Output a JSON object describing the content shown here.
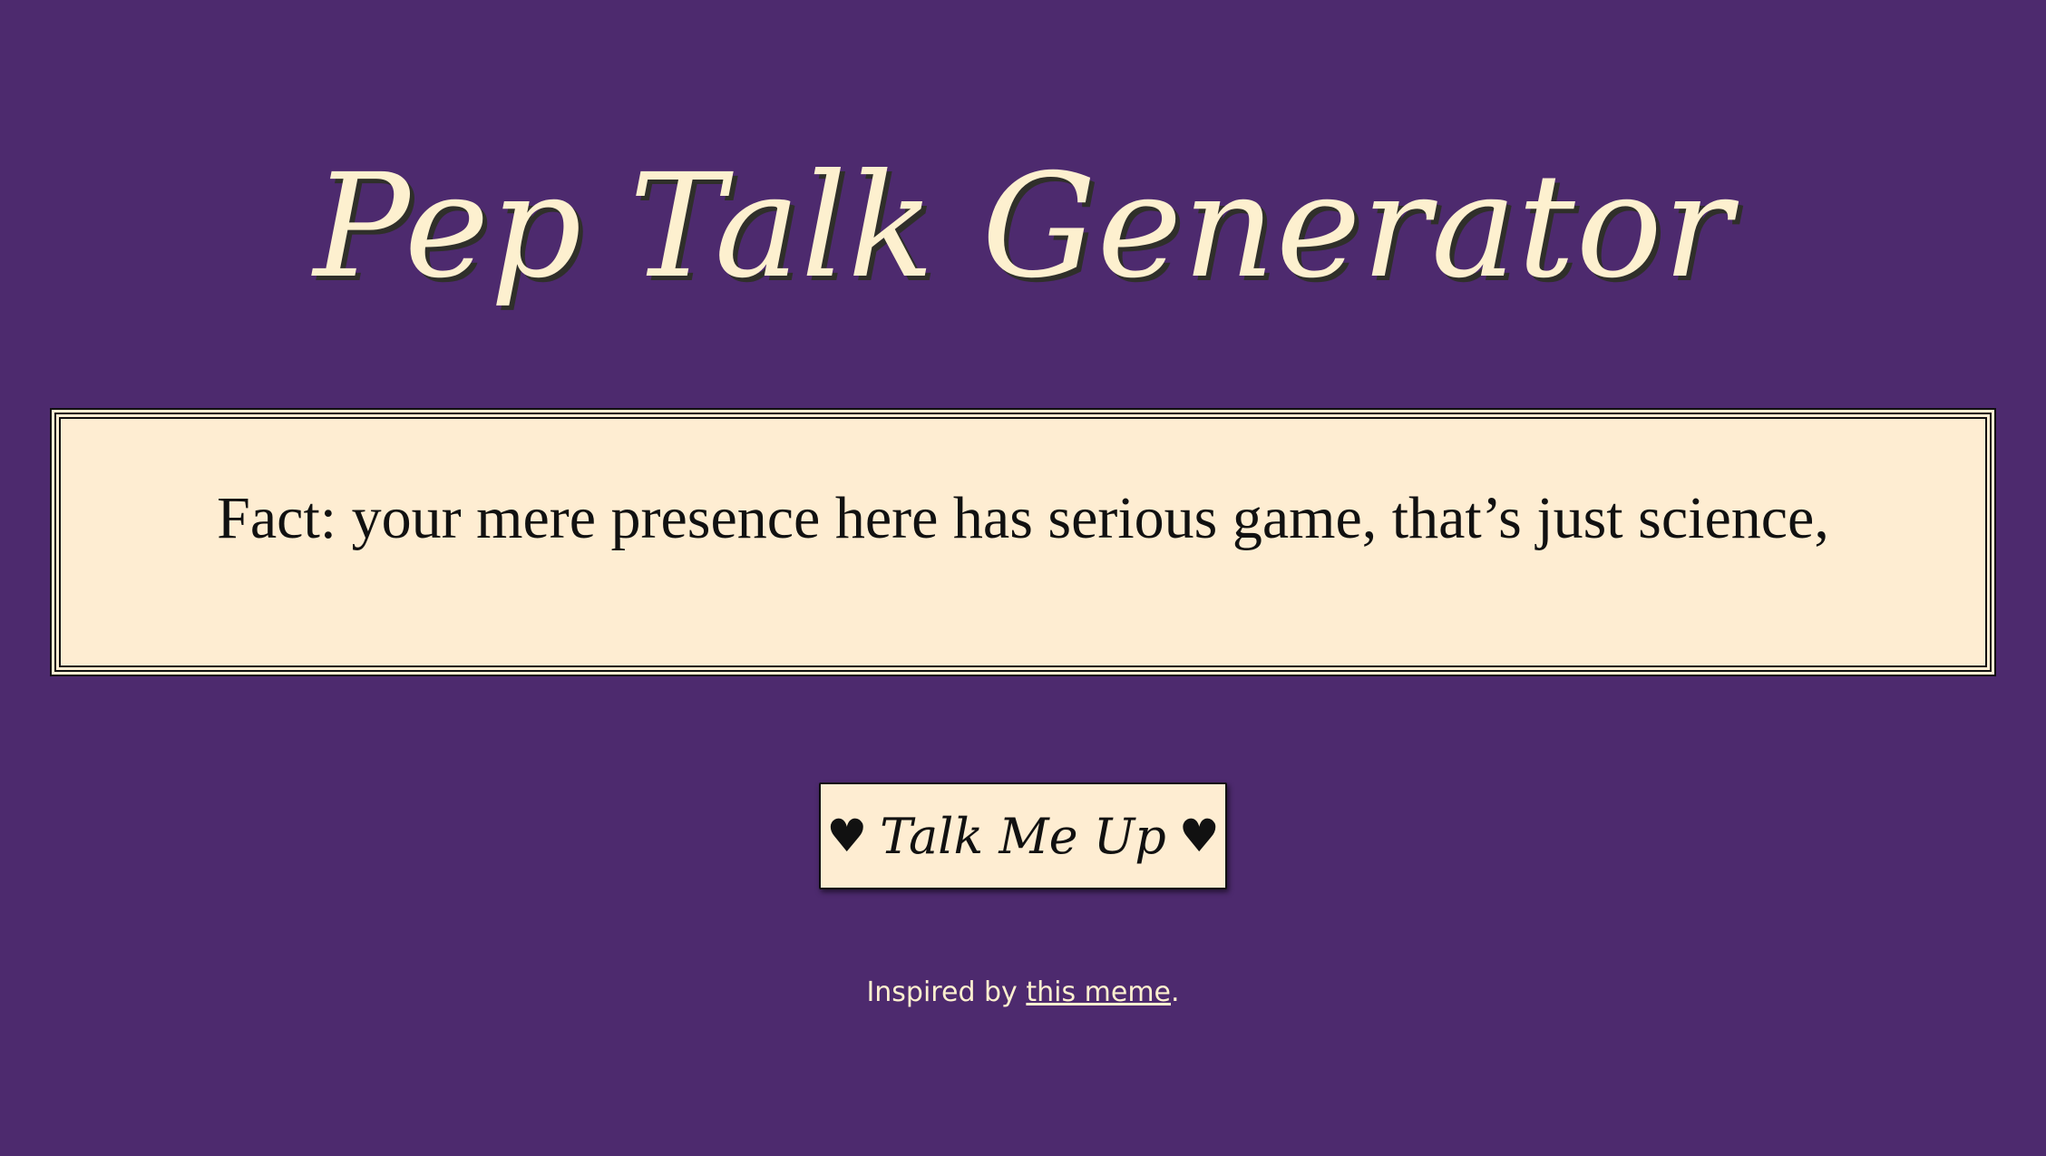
{
  "header": {
    "title": "Pep Talk Generator"
  },
  "quote": {
    "text": "Fact: your mere presence here has serious game, that’s just science,"
  },
  "button": {
    "left_symbol": "♥",
    "label": "Talk Me Up",
    "right_symbol": "♥"
  },
  "footer": {
    "prefix": "Inspired by ",
    "link_text": "this meme",
    "suffix": "."
  },
  "colors": {
    "background": "#4d2a6e",
    "cream": "#feedd2",
    "title": "#fdf0cf",
    "ink": "#111111"
  }
}
